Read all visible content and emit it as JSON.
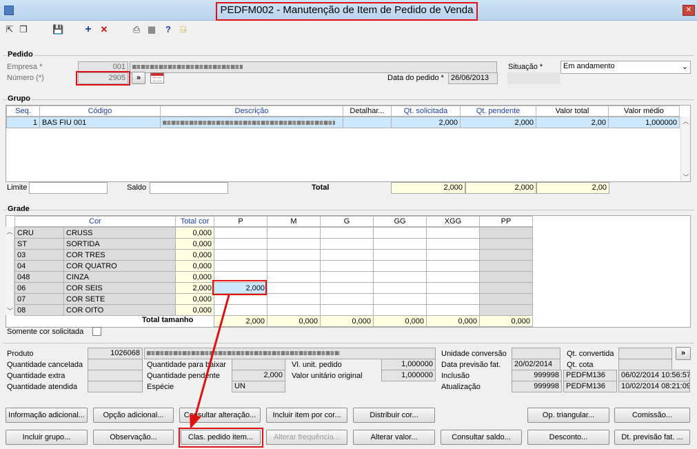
{
  "window": {
    "title": "PEDFM002 - Manutenção de Item de Pedido de Venda",
    "close": "✕"
  },
  "pedido": {
    "section": "Pedido",
    "empresa_label": "Empresa *",
    "empresa_value": "001",
    "numero_label": "Número (*)",
    "numero_value": "2905",
    "lookup_btn": "»",
    "data_label": "Data do pedido *",
    "data_value": "26/06/2013",
    "situacao_label": "Situação *",
    "situacao_value": "Em andamento"
  },
  "grupo": {
    "section": "Grupo",
    "headers": [
      "Seq.",
      "Código",
      "Descrição",
      "Detalhar...",
      "Qt. solicitada",
      "Qt. pendente",
      "Valor total",
      "Valor médio"
    ],
    "row": {
      "seq": "1",
      "codigo": "BAS FIU 001",
      "detalhar": "",
      "qt_solicitada": "2,000",
      "qt_pendente": "2,000",
      "valor_total": "2,00",
      "valor_medio": "1,000000"
    },
    "limite_label": "Limite",
    "saldo_label": "Saldo",
    "total_label": "Total",
    "total_qt_solicitada": "2,000",
    "total_qt_pendente": "2,000",
    "total_valor": "2,00"
  },
  "grade": {
    "section": "Grade",
    "cor_header": "Cor",
    "total_cor_header": "Total cor",
    "sizes": [
      "P",
      "M",
      "G",
      "GG",
      "XGG",
      "PP"
    ],
    "rows": [
      {
        "code": "CRU",
        "name": "CRUSS",
        "total": "0,000"
      },
      {
        "code": "ST",
        "name": "SORTIDA",
        "total": "0,000"
      },
      {
        "code": "03",
        "name": "COR TRES",
        "total": "0,000"
      },
      {
        "code": "04",
        "name": "COR QUATRO",
        "total": "0,000"
      },
      {
        "code": "048",
        "name": "CINZA",
        "total": "0,000"
      },
      {
        "code": "06",
        "name": "COR SEIS",
        "total": "2,000"
      },
      {
        "code": "07",
        "name": "COR SETE",
        "total": "0,000"
      },
      {
        "code": "08",
        "name": "COR OITO",
        "total": "0,000"
      }
    ],
    "edit_value": "2,000",
    "total_tamanho_label": "Total tamanho",
    "totals": [
      "2,000",
      "0,000",
      "0,000",
      "0,000",
      "0,000",
      "0,000"
    ],
    "somente_label": "Somente cor solicitada"
  },
  "info": {
    "produto_label": "Produto",
    "produto_value": "1026068",
    "qt_cancelada_label": "Quantidade cancelada",
    "qt_extra_label": "Quantidade extra",
    "qt_atendida_label": "Quantidade atendida",
    "qt_baixar_label": "Quantidade para baixar",
    "qt_pendente_label": "Quantidade pendente",
    "qt_pendente_value": "2,000",
    "especie_label": "Espécie",
    "especie_value": "UN",
    "vl_unit_label": "Vl. unit. pedido",
    "vl_unit_value": "1,000000",
    "vl_orig_label": "Valor unitário original",
    "vl_orig_value": "1,000000",
    "unidade_label": "Unidade conversão",
    "previsao_label": "Data previsão fat.",
    "previsao_value": "20/02/2014",
    "inclusao_label": "Inclusão",
    "inclusao_user": "999998",
    "inclusao_prog": "PEDFM136",
    "inclusao_dt": "06/02/2014 10:56:57",
    "atualizacao_label": "Atualização",
    "atualizacao_user": "999998",
    "atualizacao_prog": "PEDFM136",
    "atualizacao_dt": "10/02/2014 08:21:09",
    "qt_convertida_label": "Qt. convertida",
    "qt_cota_label": "Qt. cota",
    "more_btn": "»"
  },
  "buttons": {
    "info_adicional": "Informação adicional...",
    "opcao_adicional": "Opção adicional...",
    "consultar_alteracao": "Consultar alteração...",
    "incluir_item_cor": "Incluir item por cor...",
    "distribuir_cor": "Distribuir cor...",
    "op_triangular": "Op. triangular...",
    "comissao": "Comissão...",
    "incluir_grupo": "Incluir grupo...",
    "observacao": "Observação...",
    "clas_pedido_item": "Clas. pedido item...",
    "alterar_frequencia": "Alterar frequência...",
    "alterar_valor": "Alterar valor...",
    "consultar_saldo": "Consultar saldo...",
    "desconto": "Desconto...",
    "dt_previsao_fat": "Dt. previsão fat. ..."
  },
  "colors": {
    "highlight": "#e01010",
    "row_selected": "#cce8ff",
    "total_bg": "#ffffe1",
    "header_text": "#1a3ea8"
  }
}
